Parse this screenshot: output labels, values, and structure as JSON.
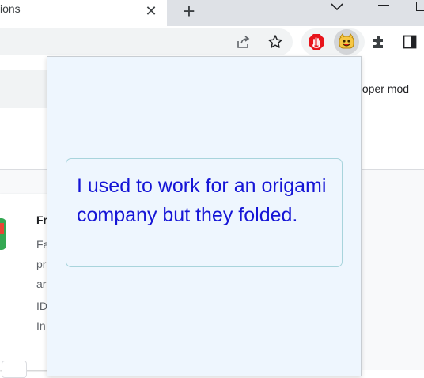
{
  "tab": {
    "title": "ions",
    "close_glyph": "✕"
  },
  "tabstrip": {
    "new_tab_glyph": "+"
  },
  "toolbar": {
    "icons": [
      "share-icon",
      "bookmark-star-icon",
      "adblock-icon",
      "joke-extension-icon",
      "extensions-puzzle-icon",
      "side-panel-icon"
    ]
  },
  "page": {
    "developer_mode_label": "veloper mod",
    "card": {
      "title_fragment": "Fr",
      "desc_line1": "Fa",
      "desc_line2": "pr",
      "desc_line3": "ar",
      "id_fragment": "ID",
      "inspect_fragment": "In"
    }
  },
  "popup": {
    "joke": "I used to work for an origami company but they folded."
  },
  "colors": {
    "joke_text": "#1515d6",
    "popup_bg": "#eef6fe",
    "adblock_red": "#e8141b",
    "extension_yellow": "#f6c744"
  }
}
